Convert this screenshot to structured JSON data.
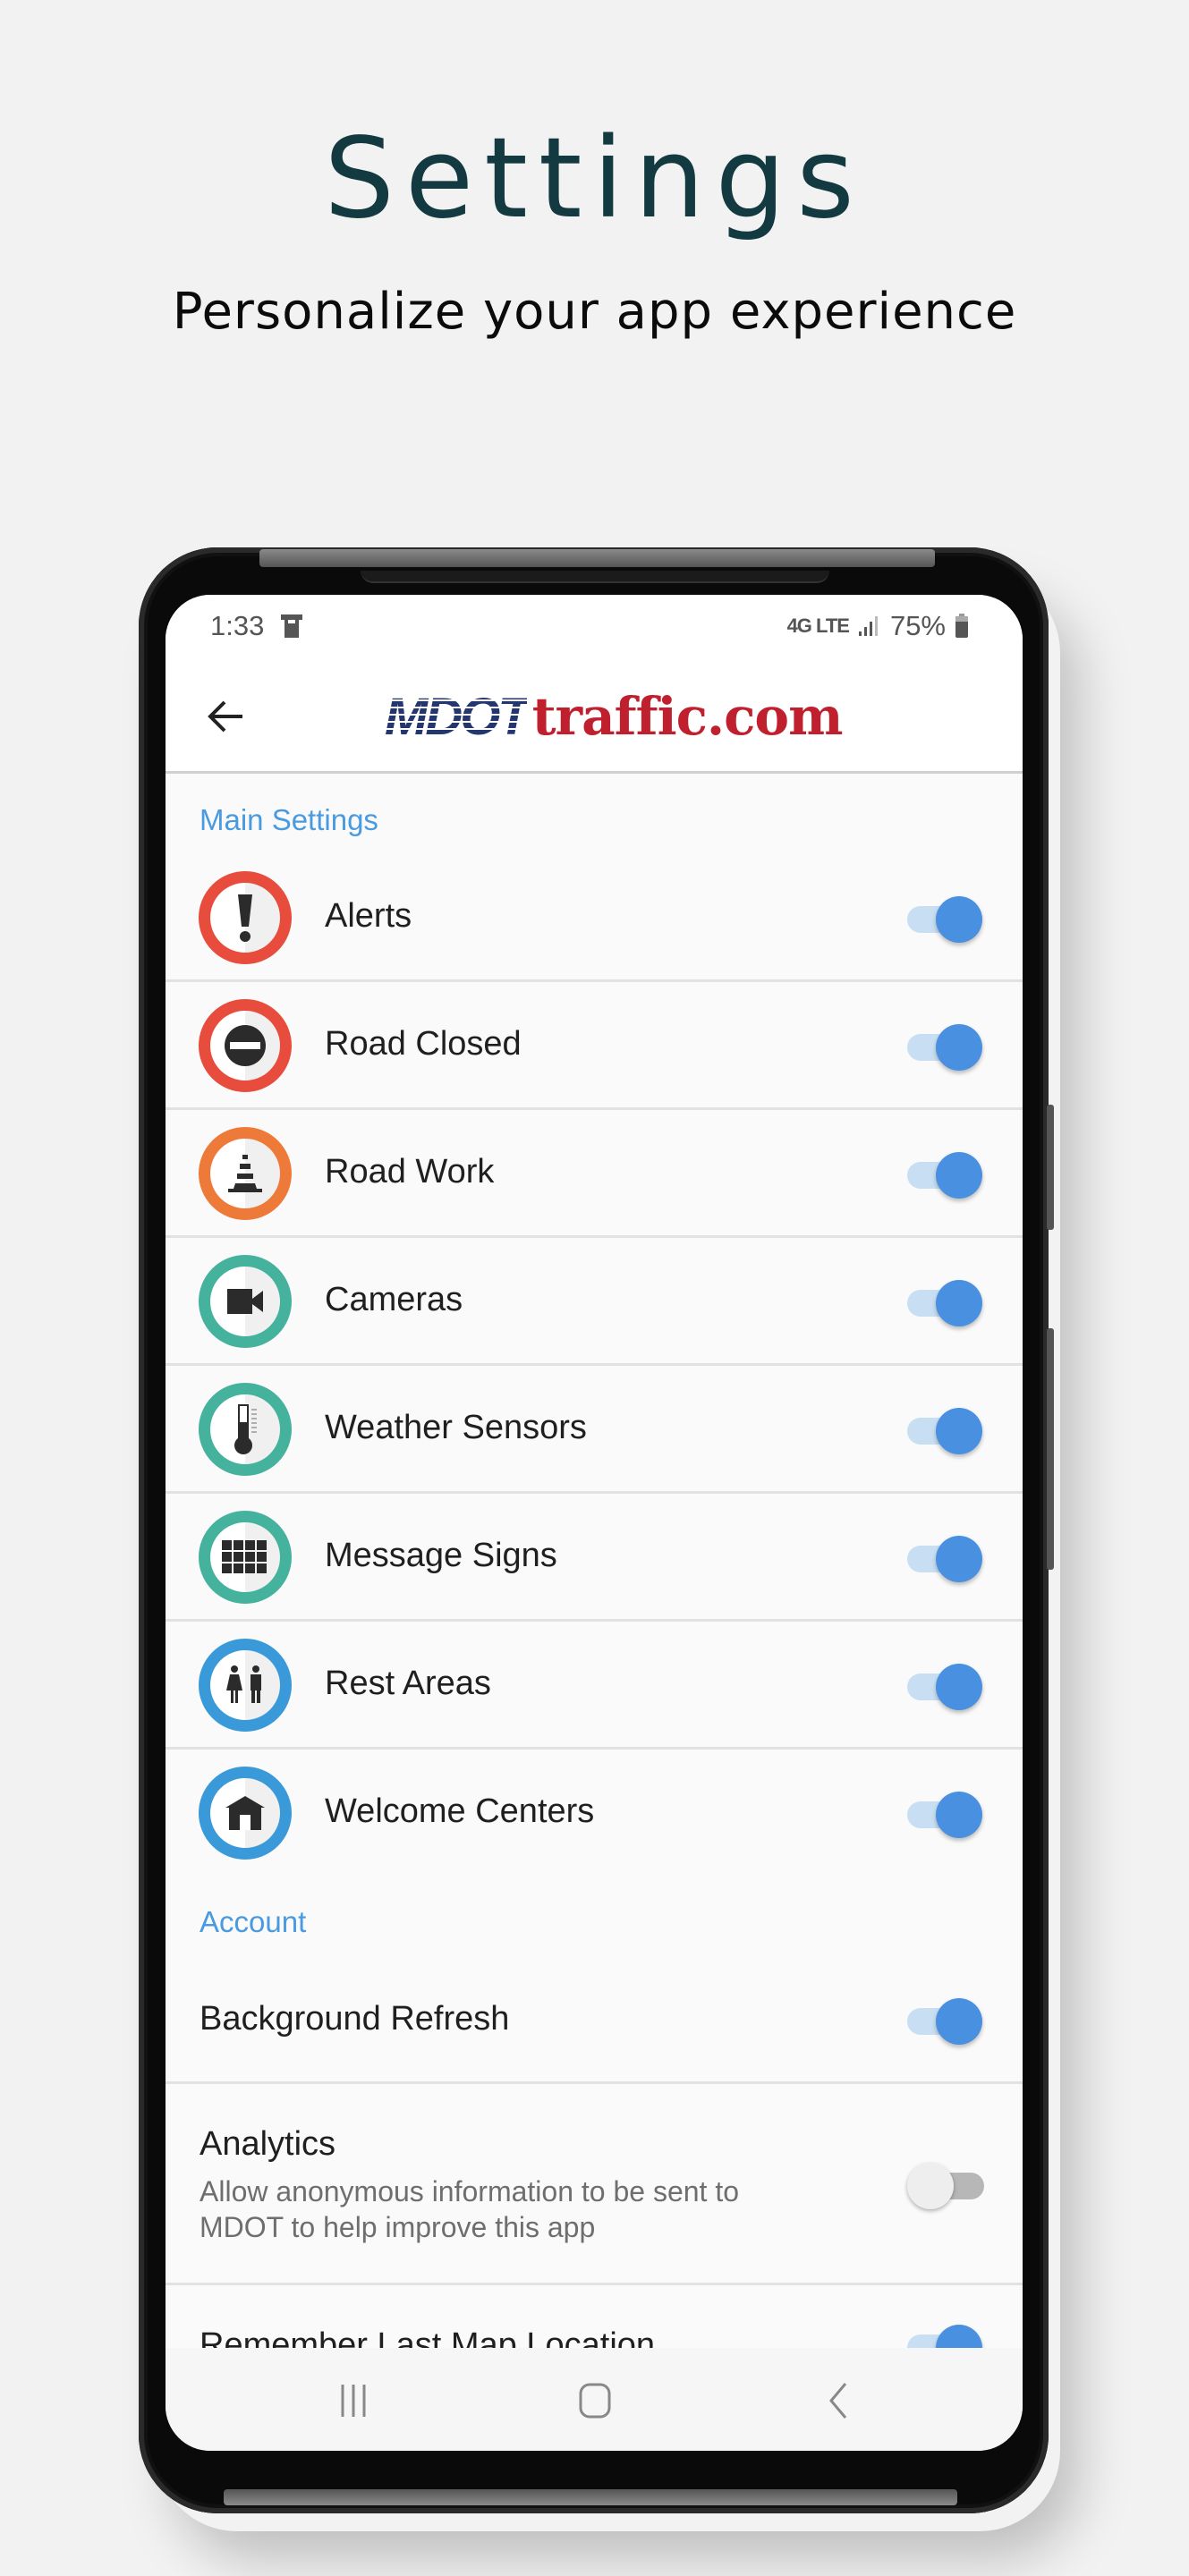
{
  "hero": {
    "title": "Settings",
    "subtitle": "Personalize your app experience"
  },
  "status_bar": {
    "time": "1:33",
    "notification_icon": "notification-icon",
    "network": "4G LTE",
    "signal_icon": "signal-bars-icon",
    "battery_percent": "75%",
    "battery_icon": "battery-icon"
  },
  "app_header": {
    "back_icon": "arrow-left-icon",
    "logo_part1": "MDOT",
    "logo_part2": "traffic.com",
    "logo_colors": {
      "mdot": "#24366e",
      "traffic": "#c0202e"
    }
  },
  "main_settings": {
    "label": "Main Settings",
    "items": [
      {
        "label": "Alerts",
        "icon": "exclamation-icon",
        "ring_color": "#e74c3c",
        "enabled": true
      },
      {
        "label": "Road Closed",
        "icon": "no-entry-icon",
        "ring_color": "#e74c3c",
        "enabled": true
      },
      {
        "label": "Road Work",
        "icon": "traffic-cone-icon",
        "ring_color": "#ee7a3a",
        "enabled": true
      },
      {
        "label": "Cameras",
        "icon": "video-camera-icon",
        "ring_color": "#45b29d",
        "enabled": true
      },
      {
        "label": "Weather Sensors",
        "icon": "thermometer-icon",
        "ring_color": "#45b29d",
        "enabled": true
      },
      {
        "label": "Message Signs",
        "icon": "message-sign-grid-icon",
        "ring_color": "#45b29d",
        "enabled": true
      },
      {
        "label": "Rest Areas",
        "icon": "restroom-icon",
        "ring_color": "#3a9ad9",
        "enabled": true
      },
      {
        "label": "Welcome Centers",
        "icon": "house-icon",
        "ring_color": "#3a9ad9",
        "enabled": true
      }
    ]
  },
  "account": {
    "label": "Account",
    "items": [
      {
        "label": "Background Refresh",
        "enabled": true
      },
      {
        "label": "Analytics",
        "description": "Allow anonymous information to be sent to MDOT to help improve this app",
        "desc_line1": "Allow anonymous information to be sent to",
        "desc_line2": "MDOT to help improve this app",
        "enabled": false
      },
      {
        "label": "Remember Last Map Location",
        "enabled": true
      }
    ]
  },
  "nav_bar": {
    "recents_icon": "recent-apps-icon",
    "home_icon": "home-button-icon",
    "back_icon": "back-chevron-icon"
  },
  "colors": {
    "accent": "#4a90e0",
    "section_label": "#4a9ae0",
    "title": "#133a40"
  }
}
